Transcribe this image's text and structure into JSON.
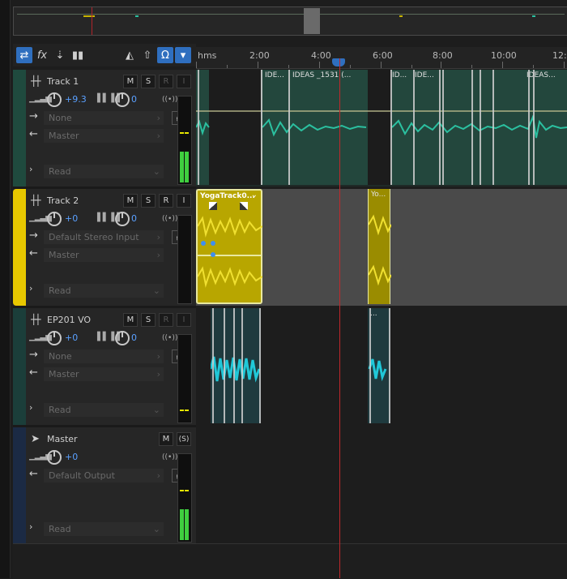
{
  "toolbar": {
    "buttons": [
      "switch-arrows-icon",
      "fx-icon",
      "insert-icon",
      "bars-icon",
      "metronome-icon",
      "export-icon",
      "headphones-icon",
      "marker-icon"
    ]
  },
  "ruler": {
    "unit": "hms",
    "labels": [
      "2:00",
      "4:00",
      "6:00",
      "8:00",
      "10:00",
      "12:0"
    ]
  },
  "tracks": [
    {
      "name": "Track 1",
      "volume": "+9.3",
      "pan": "0",
      "input": "None",
      "output": "Master",
      "automation": "Read",
      "color": "#2b6b58",
      "selected": false
    },
    {
      "name": "Track 2",
      "volume": "+0",
      "pan": "0",
      "input": "Default Stereo Input",
      "output": "Master",
      "automation": "Read",
      "color": "#e8c800",
      "selected": true
    },
    {
      "name": "EP201 VO",
      "volume": "+0",
      "pan": "0",
      "input": "None",
      "output": "Master",
      "automation": "Read",
      "color": "#205a5a",
      "selected": false
    },
    {
      "name": "Master",
      "volume": "+0",
      "output": "Default Output",
      "automation": "Read",
      "color": "#20304a",
      "selected": false
    }
  ],
  "clips": {
    "track1": [
      "IDE...",
      "IDEAS _1531 (...",
      "ID...",
      "IDE...",
      "IDEAS..."
    ],
    "track2": [
      "YogaTrack0...",
      "Yo..."
    ],
    "track3": [
      "..."
    ]
  },
  "buttons": {
    "mute": "M",
    "solo": "S",
    "record": "R",
    "input": "I",
    "master_solo": "(S)"
  },
  "colors": {
    "accent": "#2f6fbf",
    "playhead": "#c0282c",
    "meter": "#3fcf3f",
    "clip_teal": "#2bc0a0",
    "clip_yellow": "#c8b400",
    "clip_cyan": "#20c8d8"
  }
}
